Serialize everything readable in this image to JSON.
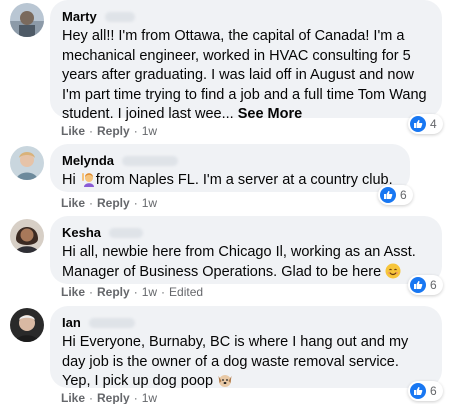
{
  "colors": {
    "bubble": "#f0f2f5",
    "meta_text": "#65676b",
    "like_blue": "#1877f2",
    "text": "#050505"
  },
  "comments": [
    {
      "author": "Marty",
      "text": "Hey all!! I'm from Ottawa, the capital of Canada! I'm a mechanical engineer, worked in HVAC consulting for 5 years after graduating. I was laid off in August and now I'm part time trying to find a job and a full time Tom Wang student. I joined last wee... ",
      "see_more": "See More",
      "like": "Like",
      "reply": "Reply",
      "time": "1w",
      "reaction_count": "4",
      "reaction_icon": "like-icon"
    },
    {
      "author": "Melynda",
      "text_before": "Hi ",
      "emoji": "woman-raising-hand",
      "text_after": "from Naples FL. I'm a server at a country club.",
      "like": "Like",
      "reply": "Reply",
      "time": "1w",
      "reaction_count": "6",
      "reaction_icon": "like-icon"
    },
    {
      "author": "Kesha",
      "text": "Hi all, newbie here from Chicago Il, working as an Asst. Manager of Business Operations. Glad to be here ",
      "emoji": "smiling-face",
      "like": "Like",
      "reply": "Reply",
      "time": "1w",
      "edited": "Edited",
      "reaction_count": "6",
      "reaction_icon": "like-icon"
    },
    {
      "author": "Ian",
      "text": "Hi Everyone, Burnaby, BC is where I hang out and my day job is the owner of a dog waste removal service. Yep, I pick up dog poop ",
      "emoji": "dog-face",
      "like": "Like",
      "reply": "Reply",
      "time": "1w",
      "reaction_count": "6",
      "reaction_icon": "like-icon"
    }
  ]
}
